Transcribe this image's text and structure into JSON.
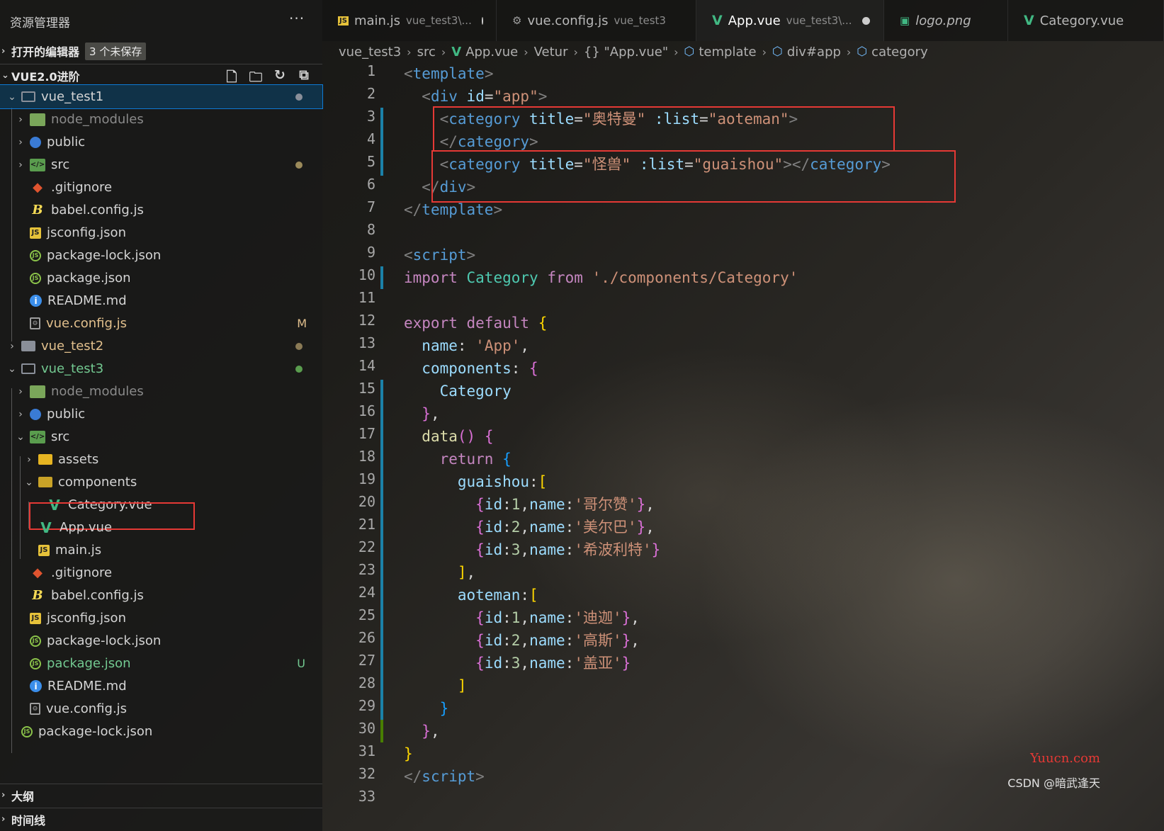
{
  "sidebar": {
    "title": "资源管理器",
    "more": "···",
    "open_editors": {
      "label": "打开的编辑器",
      "badge": "3 个未保存"
    },
    "workspace": {
      "label": "VUE2.0进阶"
    },
    "tree": [
      {
        "label": "vue_test1",
        "status": "dot"
      },
      {
        "label": "node_modules"
      },
      {
        "label": "public"
      },
      {
        "label": "src",
        "status": "dot"
      },
      {
        "label": ".gitignore"
      },
      {
        "label": "babel.config.js"
      },
      {
        "label": "jsconfig.json"
      },
      {
        "label": "package-lock.json"
      },
      {
        "label": "package.json"
      },
      {
        "label": "README.md"
      },
      {
        "label": "vue.config.js",
        "status": "M"
      },
      {
        "label": "vue_test2",
        "status": "dot"
      },
      {
        "label": "vue_test3",
        "status": "dot"
      },
      {
        "label": "node_modules"
      },
      {
        "label": "public"
      },
      {
        "label": "src"
      },
      {
        "label": "assets"
      },
      {
        "label": "components"
      },
      {
        "label": "Category.vue"
      },
      {
        "label": "App.vue"
      },
      {
        "label": "main.js"
      },
      {
        "label": ".gitignore"
      },
      {
        "label": "babel.config.js"
      },
      {
        "label": "jsconfig.json"
      },
      {
        "label": "package-lock.json"
      },
      {
        "label": "package.json",
        "status": "U"
      },
      {
        "label": "README.md"
      },
      {
        "label": "vue.config.js"
      },
      {
        "label": "package-lock.json"
      }
    ],
    "outline": "大纲",
    "timeline": "时间线"
  },
  "icons": {
    "js": "JS",
    "src": "</>",
    "json": "JS",
    "info": "i",
    "vue": "V",
    "babel": "B",
    "git": "◆",
    "chevron_right": "›",
    "chevron_down": "⌄"
  },
  "tabs": [
    {
      "label": "main.js",
      "desc": "vue_test3\\..."
    },
    {
      "label": "vue.config.js",
      "desc": "vue_test3"
    },
    {
      "label": "App.vue",
      "desc": "vue_test3\\..."
    },
    {
      "label": "logo.png",
      "desc": ""
    },
    {
      "label": "Category.vue",
      "desc": ""
    }
  ],
  "breadcrumb": [
    "vue_test3",
    "src",
    "App.vue",
    "Vetur",
    "{} \"App.vue\"",
    "template",
    "div#app",
    "category"
  ],
  "editor": {
    "line_numbers": [
      "1",
      "2",
      "3",
      "4",
      "5",
      "6",
      "7",
      "8",
      "9",
      "10",
      "11",
      "12",
      "13",
      "14",
      "15",
      "16",
      "17",
      "18",
      "19",
      "20",
      "21",
      "22",
      "23",
      "24",
      "25",
      "26",
      "27",
      "28",
      "29",
      "30",
      "31",
      "32",
      "33"
    ]
  },
  "watermark": {
    "site": "Yuucn.com",
    "author": "CSDN @暗武逢天"
  }
}
